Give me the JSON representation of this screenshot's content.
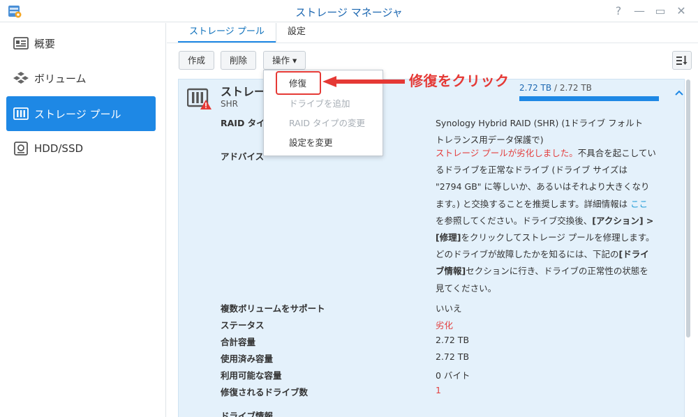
{
  "window": {
    "title": "ストレージ マネージャ",
    "help": "?",
    "minimize": "—",
    "maximize": "▭",
    "close": "✕"
  },
  "sidebar": {
    "items": [
      {
        "label": "概要",
        "icon": "overview-icon"
      },
      {
        "label": "ボリューム",
        "icon": "volume-icon"
      },
      {
        "label": "ストレージ プール",
        "icon": "storage-pool-icon",
        "active": true
      },
      {
        "label": "HDD/SSD",
        "icon": "hdd-icon"
      }
    ]
  },
  "tabs": [
    {
      "label": "ストレージ プール",
      "active": true
    },
    {
      "label": "設定"
    }
  ],
  "toolbar": {
    "create": "作成",
    "delete": "削除",
    "action": "操作 ▾"
  },
  "menu": {
    "items": [
      {
        "label": "修復",
        "enabled": true
      },
      {
        "label": "ドライブを追加",
        "enabled": false
      },
      {
        "label": "RAID タイプの変更",
        "enabled": false
      },
      {
        "label": "設定を変更",
        "enabled": true
      }
    ]
  },
  "annotation": {
    "text": "修復をクリック",
    "color": "#e53935"
  },
  "pool": {
    "name": "ストレー",
    "type": "SHR",
    "capacity_used": "2.72 TB",
    "capacity_sep": "/",
    "capacity_total": "2.72 TB",
    "capacity_fill": 1.0,
    "raid_label": "RAID タイ",
    "raid_value_1": "Synology Hybrid RAID (SHR) (1ドライブ フォルト",
    "raid_value_2": "トレランス用データ保護で)",
    "advice_label": "アドバイス",
    "advice": {
      "warn": "ストレージ プールが劣化しました。",
      "line1_rest": "不具合を起こしてい",
      "line2": "るドライブを正常なドライブ (ドライブ サイズは",
      "line3": "\"2794 GB\" に等しいか、あるいはそれより大きくなり",
      "line4_pre": "ます。) と交換することを推奨します。詳細情報は ",
      "link": "ここ",
      "line5": "を参照してください。ドライブ交換後、",
      "line5_bold": "[アクション] >",
      "line6_bold": "[修理]",
      "line6_rest": "をクリックしてストレージ プールを修理します。",
      "line7_pre": "どのドライブが故障したかを知るには、下記の",
      "line7_bold": "[ドライ",
      "line8_bold": "ブ情報]",
      "line8_rest": "セクションに行き、ドライブの正常性の状態を",
      "line9": "見てください。"
    },
    "rows": [
      {
        "label": "複数ボリュームをサポート",
        "value": "いいえ"
      },
      {
        "label": "ステータス",
        "value": "劣化"
      },
      {
        "label": "合計容量",
        "value": "2.72 TB"
      },
      {
        "label": "使用済み容量",
        "value": "2.72 TB"
      },
      {
        "label": "利用可能な容量",
        "value": "0 バイト"
      },
      {
        "label": "修復されるドライブ数",
        "value": "1"
      }
    ],
    "drive_info_label": "ドライブ情報"
  }
}
